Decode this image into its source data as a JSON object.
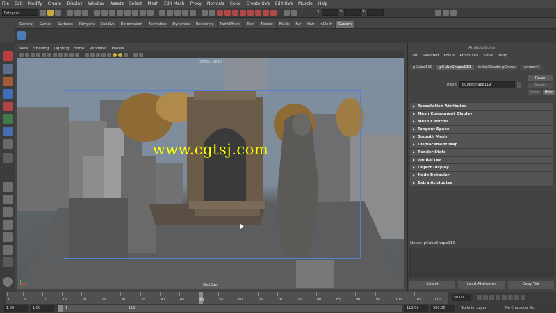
{
  "menubar": [
    "File",
    "Edit",
    "Modify",
    "Create",
    "Display",
    "Window",
    "Assets",
    "Select",
    "Mesh",
    "Edit Mesh",
    "Proxy",
    "Normals",
    "Color",
    "Create UVs",
    "Edit UVs",
    "Muscle",
    "Help"
  ],
  "status": {
    "mode": "Polygons",
    "x_label": "X:",
    "y_label": "Y:",
    "z_label": "Z:"
  },
  "shelf_tabs": [
    "General",
    "Curves",
    "Surfaces",
    "Polygons",
    "Subdivs",
    "Deformation",
    "Animation",
    "Dynamics",
    "Rendering",
    "PaintEffects",
    "Toon",
    "Muscle",
    "Fluids",
    "Fur",
    "Hair",
    "nCloth",
    "Custom"
  ],
  "shelf_active": "Custom",
  "viewport": {
    "menu": [
      "View",
      "Shading",
      "Lighting",
      "Show",
      "Renderer",
      "Panels"
    ],
    "resolution": "5760 x 3240",
    "camera": "ShotCam",
    "watermark": "www.cgtsj.com"
  },
  "attribute_editor": {
    "title": "Attribute Editor",
    "menu": [
      "List",
      "Selected",
      "Focus",
      "Attributes",
      "Show",
      "Help"
    ],
    "tabs": [
      "pCube119",
      "pCubeShape119",
      "initialShadingGroup",
      "lambert1"
    ],
    "active_tab": "pCubeShape119",
    "mesh_label": "mesh:",
    "mesh_value": "pCubeShape119",
    "focus_label": "Focus",
    "presets_label": "Presets",
    "show_label": "Show",
    "hide_label": "Hide",
    "sections": [
      "Tessellation Attributes",
      "Mesh Component Display",
      "Mesh Controls",
      "Tangent Space",
      "Smooth Mesh",
      "Displacement Map",
      "Render Stats",
      "mental ray",
      "Object Display",
      "Node Behavior",
      "Extra Attributes"
    ],
    "notes_label": "Notes: pCubeShape119",
    "buttons": {
      "select": "Select",
      "load": "Load Attributes",
      "copy": "Copy Tab"
    }
  },
  "timeline": {
    "ticks": [
      "1",
      "5",
      "10",
      "15",
      "20",
      "25",
      "30",
      "35",
      "40",
      "45",
      "50",
      "55",
      "60",
      "65",
      "70",
      "75",
      "80",
      "85",
      "90",
      "95",
      "100",
      "105",
      "110"
    ],
    "current_frame": "50.00",
    "marker": "50"
  },
  "range": {
    "start": "1.00",
    "start2": "1.00",
    "inner_start": "1",
    "inner_end": "113",
    "end": "113.00",
    "end2": "500.00",
    "anim_layer": "No Anim Layer",
    "character_set": "No Character Set"
  }
}
